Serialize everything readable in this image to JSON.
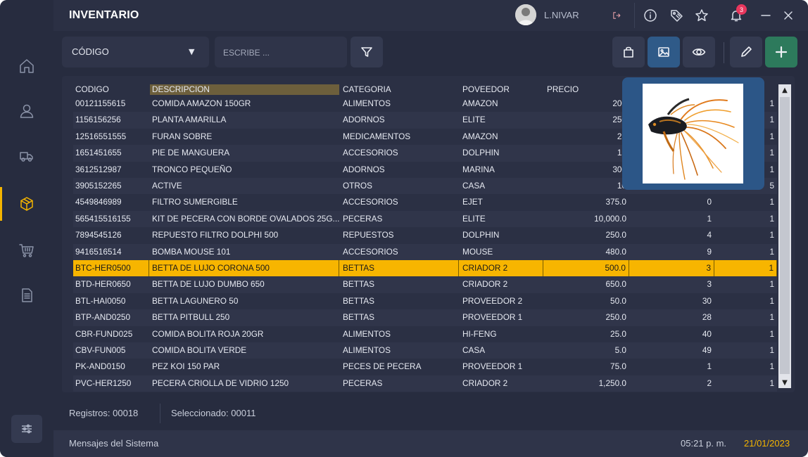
{
  "header": {
    "title": "INVENTARIO",
    "user_name": "L.NIVAR",
    "notification_count": "3"
  },
  "toolbar": {
    "filter_field_label": "CÓDIGO",
    "search_placeholder": "ESCRIBE ..."
  },
  "table": {
    "columns": [
      "CODIGO",
      "DESCRIPCION",
      "CATEGORIA",
      "POVEEDOR",
      "PRECIO"
    ],
    "sorted_column": "DESCRIPCION",
    "selected_index": 10,
    "rows": [
      {
        "codigo": "00121155615",
        "descripcion": "COMIDA AMAZON 150GR",
        "categoria": "ALIMENTOS",
        "proveedor": "AMAZON",
        "precio": "200",
        "stock": "",
        "extra": "1"
      },
      {
        "codigo": "1156156256",
        "descripcion": "PLANTA AMARILLA",
        "categoria": "ADORNOS",
        "proveedor": "ELITE",
        "precio": "250",
        "stock": "",
        "extra": "1"
      },
      {
        "codigo": "12516551555",
        "descripcion": "FURAN SOBRE",
        "categoria": "MEDICAMENTOS",
        "proveedor": "AMAZON",
        "precio": "25",
        "stock": "",
        "extra": "1"
      },
      {
        "codigo": "1651451655",
        "descripcion": "PIE DE MANGUERA",
        "categoria": "ACCESORIOS",
        "proveedor": "DOLPHIN",
        "precio": "15",
        "stock": "",
        "extra": "1"
      },
      {
        "codigo": "3612512987",
        "descripcion": "TRONCO PEQUEÑO",
        "categoria": "ADORNOS",
        "proveedor": "MARINA",
        "precio": "300",
        "stock": "",
        "extra": "1"
      },
      {
        "codigo": "3905152265",
        "descripcion": "ACTIVE",
        "categoria": "OTROS",
        "proveedor": "CASA",
        "precio": "10",
        "stock": "",
        "extra": "5"
      },
      {
        "codigo": "4549846989",
        "descripcion": "FILTRO SUMERGIBLE",
        "categoria": "ACCESORIOS",
        "proveedor": "EJET",
        "precio": "375.0",
        "stock": "0",
        "extra": "1"
      },
      {
        "codigo": "565415516155",
        "descripcion": "KIT DE PECERA CON BORDE OVALADOS 25G...",
        "categoria": "PECERAS",
        "proveedor": "ELITE",
        "precio": "10,000.0",
        "stock": "1",
        "extra": "1"
      },
      {
        "codigo": "7894545126",
        "descripcion": "REPUESTO FILTRO DOLPHI 500",
        "categoria": "REPUESTOS",
        "proveedor": "DOLPHIN",
        "precio": "250.0",
        "stock": "4",
        "extra": "1"
      },
      {
        "codigo": "9416516514",
        "descripcion": "BOMBA MOUSE 101",
        "categoria": "ACCESORIOS",
        "proveedor": "MOUSE",
        "precio": "480.0",
        "stock": "9",
        "extra": "1"
      },
      {
        "codigo": "BTC-HER0500",
        "descripcion": "BETTA DE LUJO CORONA 500",
        "categoria": "BETTAS",
        "proveedor": "CRIADOR 2",
        "precio": "500.0",
        "stock": "3",
        "extra": "1"
      },
      {
        "codigo": "BTD-HER0650",
        "descripcion": "BETTA DE LUJO DUMBO 650",
        "categoria": "BETTAS",
        "proveedor": "CRIADOR 2",
        "precio": "650.0",
        "stock": "3",
        "extra": "1"
      },
      {
        "codigo": "BTL-HAI0050",
        "descripcion": "BETTA LAGUNERO 50",
        "categoria": "BETTAS",
        "proveedor": "PROVEEDOR 2",
        "precio": "50.0",
        "stock": "30",
        "extra": "1"
      },
      {
        "codigo": "BTP-AND0250",
        "descripcion": "BETTA PITBULL 250",
        "categoria": "BETTAS",
        "proveedor": "PROVEEDOR 1",
        "precio": "250.0",
        "stock": "28",
        "extra": "1"
      },
      {
        "codigo": "CBR-FUND025",
        "descripcion": "COMIDA BOLITA ROJA 20GR",
        "categoria": "ALIMENTOS",
        "proveedor": "HI-FENG",
        "precio": "25.0",
        "stock": "40",
        "extra": "1"
      },
      {
        "codigo": "CBV-FUN005",
        "descripcion": "COMIDA BOLITA VERDE",
        "categoria": "ALIMENTOS",
        "proveedor": "CASA",
        "precio": "5.0",
        "stock": "49",
        "extra": "1"
      },
      {
        "codigo": "PK-AND0150",
        "descripcion": "PEZ KOI 150 PAR",
        "categoria": "PECES DE PECERA",
        "proveedor": "PROVEEDOR 1",
        "precio": "75.0",
        "stock": "1",
        "extra": "1"
      },
      {
        "codigo": "PVC-HER1250",
        "descripcion": "PECERA CRIOLLA DE VIDRIO 1250",
        "categoria": "PECERAS",
        "proveedor": "CRIADOR 2",
        "precio": "1,250.0",
        "stock": "2",
        "extra": "1"
      }
    ]
  },
  "status": {
    "records": "Registros: 00018",
    "selected": "Seleccionado: 00011"
  },
  "footer": {
    "messages": "Mensajes del Sistema",
    "time": "05:21 p. m.",
    "date": "21/01/2023"
  },
  "colors": {
    "accent": "#f4b400",
    "selected_row": "#f7b500",
    "image_panel": "#2c5687",
    "add_button": "#2d7a5c"
  }
}
